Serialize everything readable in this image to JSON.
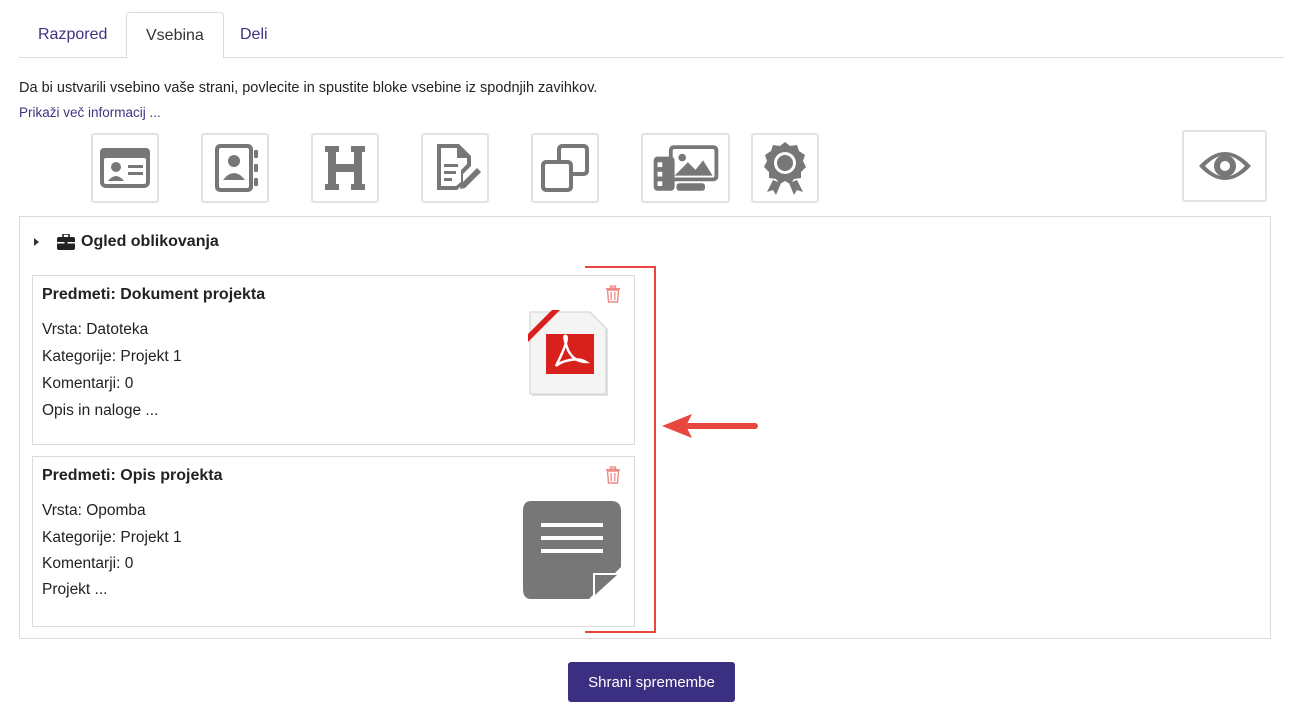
{
  "tabs": [
    {
      "label": "Razpored",
      "active": false
    },
    {
      "label": "Vsebina",
      "active": true
    },
    {
      "label": "Deli",
      "active": false
    }
  ],
  "intro": {
    "text": "Da bi ustvarili vsebino vaše strani, povlecite in spustite bloke vsebine iz spodnjih zavihkov.",
    "more_link": "Prikaži več informacij ..."
  },
  "toolbar": {
    "icons": [
      "profile-card-icon",
      "contact-book-icon",
      "heading-icon",
      "text-edit-icon",
      "copy-icon",
      "gallery-icon",
      "badge-icon",
      "eye-icon"
    ]
  },
  "section": {
    "title": "Ogled oblikovanja"
  },
  "blocks": [
    {
      "title": "Predmeti: Dokument projekta",
      "type": "Vrsta: Datoteka",
      "category": "Kategorije: Projekt 1",
      "comments": "Komentarji: 0",
      "description": "Opis in naloge ..."
    },
    {
      "title": "Predmeti: Opis projekta",
      "type": "Vrsta: Opomba",
      "category": "Kategorije: Projekt 1",
      "comments": "Komentarji: 0",
      "description": "Projekt ..."
    }
  ],
  "save_button": "Shrani spremembe",
  "colors": {
    "accent": "#3a2f80",
    "link": "#3d3580",
    "annotation": "#e8473f",
    "icon": "#777777"
  }
}
